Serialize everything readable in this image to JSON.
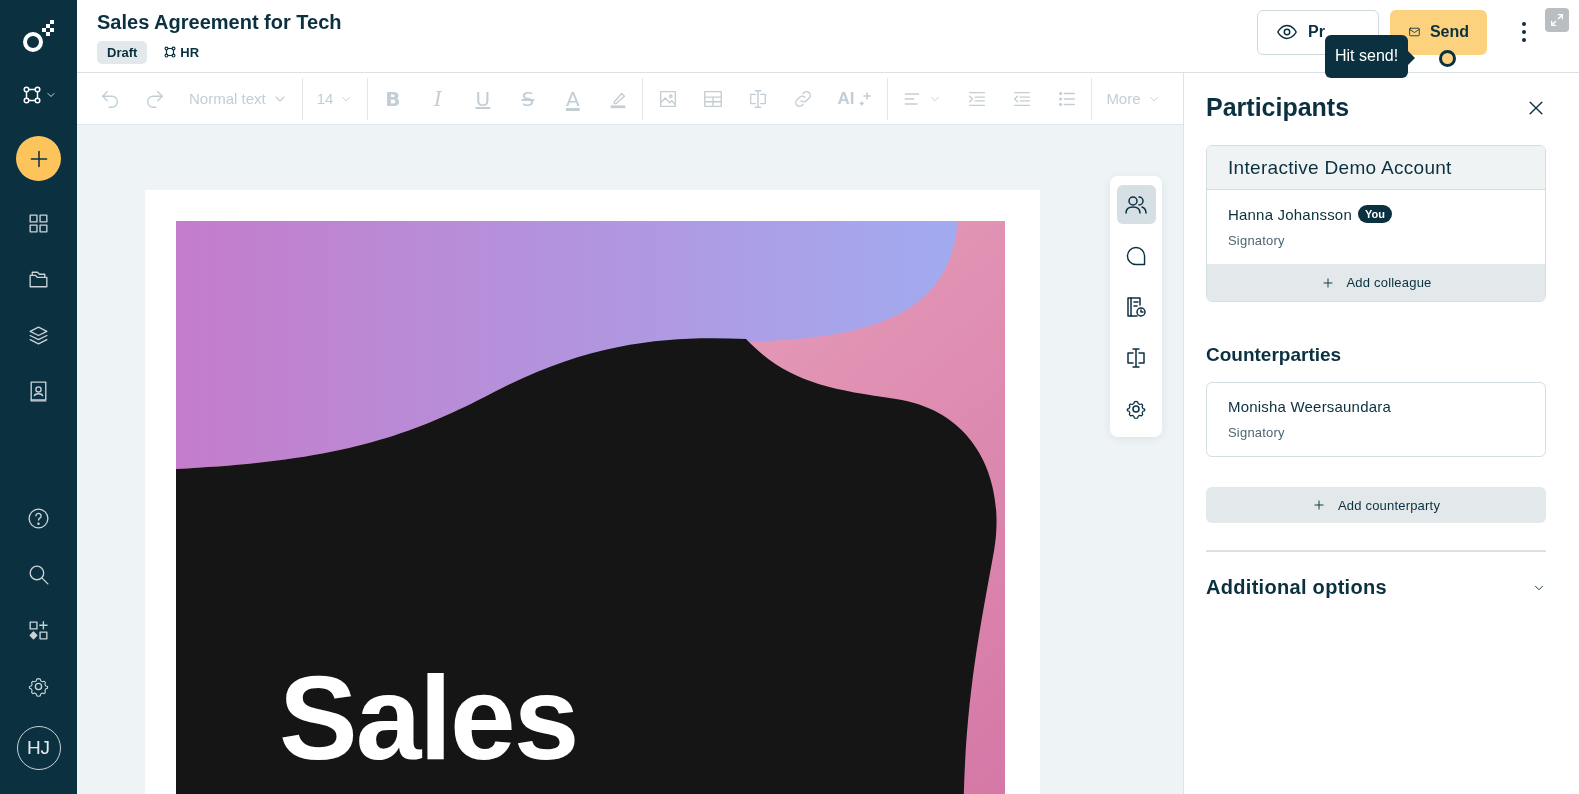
{
  "sidebar": {
    "avatar": "HJ"
  },
  "header": {
    "title": "Sales Agreement for Tech",
    "status": "Draft",
    "tag": "HR",
    "preview_button": "Pr",
    "send_button": "Send"
  },
  "tooltip": "Hit send!",
  "toolbar": {
    "disabled": true,
    "style_select": "Normal text",
    "font_size": "14",
    "format_buttons": [
      "B",
      "I",
      "U",
      "S",
      "A"
    ],
    "ai_button": "AI",
    "more": "More"
  },
  "document": {
    "cover_title": [
      "Sales"
    ]
  },
  "side_tools": [
    {
      "kind": "participants",
      "selected": true
    },
    {
      "kind": "comments",
      "selected": false
    },
    {
      "kind": "history",
      "selected": false
    },
    {
      "kind": "fields",
      "selected": false
    },
    {
      "kind": "settings",
      "selected": false
    }
  ],
  "panel": {
    "title": "Participants",
    "own_party": {
      "name": "Interactive Demo Account",
      "participants": [
        {
          "name": "Hanna Johansson",
          "badge": "You",
          "role": "Signatory"
        }
      ],
      "add_button": "Add colleague"
    },
    "counterparties": {
      "heading": "Counterparties",
      "participants": [
        {
          "name": "Monisha Weersaundara",
          "role": "Signatory"
        }
      ],
      "add_button": "Add counterparty"
    },
    "additional_options": {
      "label": "Additional options",
      "expanded": false
    }
  }
}
